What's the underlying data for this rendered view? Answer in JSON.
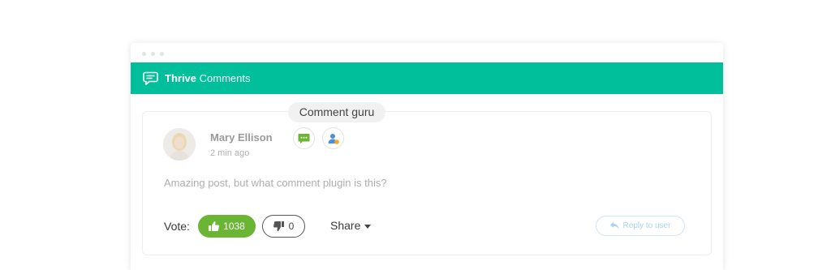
{
  "app": {
    "brand_bold": "Thrive",
    "brand_light": "Comments"
  },
  "tooltip": "Comment guru",
  "comment": {
    "author": "Mary Ellison",
    "time": "2 min ago",
    "text": "Amazing post, but what comment plugin is this?"
  },
  "badges": [
    "comment-badge-icon",
    "user-badge-icon"
  ],
  "vote": {
    "label": "Vote:",
    "upvotes": "1038",
    "downvotes": "0"
  },
  "share_label": "Share",
  "reply_label": "Reply to user",
  "colors": {
    "header": "#00bf9a",
    "upvote": "#6ab534",
    "badge": "#6ab534",
    "reply": "#a9d2ec"
  }
}
